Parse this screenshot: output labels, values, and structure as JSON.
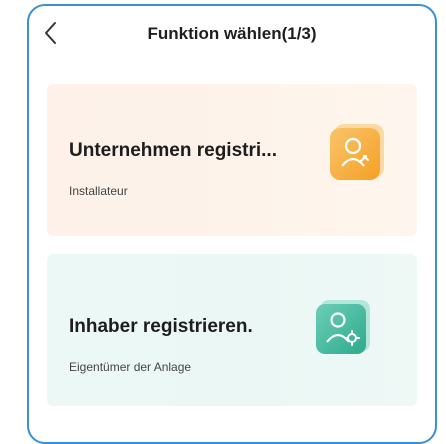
{
  "header": {
    "title": "Funktion wählen(1/3)",
    "back_icon": "chevron-left-icon"
  },
  "cards": [
    {
      "title": "Unternehmen registri...",
      "subtitle": "Installateur",
      "icon": "installer-icon",
      "accent": "#f6a327"
    },
    {
      "title": "Inhaber registrieren.",
      "subtitle": "Eigentümer der Anlage",
      "icon": "owner-icon",
      "accent": "#3db59b"
    }
  ],
  "colors": {
    "frame_border": "#3a8fd6",
    "installer_bg": "#fdf1e9",
    "owner_bg": "#ecf8f6"
  }
}
